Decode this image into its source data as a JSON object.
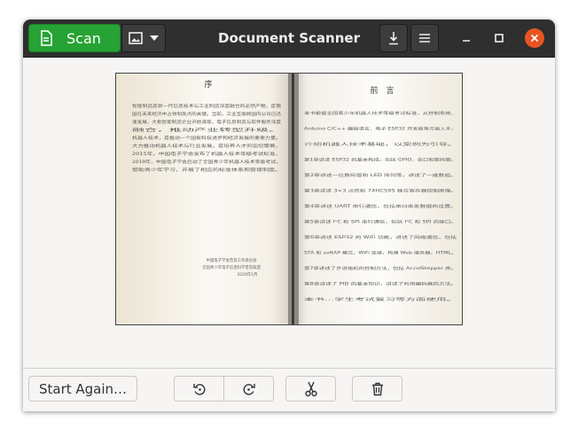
{
  "window": {
    "title": "Document Scanner"
  },
  "toolbar": {
    "scan_label": "Scan",
    "scan_icon": "document-icon",
    "type_icon": "photo-icon",
    "save_icon": "download-icon",
    "menu_icon": "hamburger-menu-icon"
  },
  "colors": {
    "accent": "#26a334",
    "header_bg": "#2f2f2f",
    "close": "#e95420"
  },
  "scan": {
    "left_page": {
      "heading": "序",
      "lines": [
        "智能制造是新一代信息技术与工业制造深度融合的必然产物，是我",
        "国在未来经济中占领制高点的关键。当前，工业互联网国内公司已迅",
        "速发展，大批智能制造企业开始涌现，电子信息制造与软件服务深度",
        "融合，推动产业转型升级。",
        "机器人技术，是推动一个国家科技进步和经济发展的重要力量。",
        "大力推动机器人技术与行业发展，是培养人才的迫切需要。",
        "2015年，中国电子学会发布了机器人技术等级考试标准，",
        "2019年，中国电子学会启动了全国青少年机器人技术等级考试，",
        "帮助青少年学习，开展了相应的标准体系和管理制度。"
      ],
      "signature": "中国电子学会普及工作委员会",
      "signature2": "全国青少年电子信息科学普及联盟",
      "date": "2020年1月"
    },
    "right_page": {
      "heading": "前　言",
      "lines": [
        "本书根据全国青少年机器人技术等级考试标准，从控制系统、",
        "Arduino C/C++ 编程语言、电子 ESP32 开发板等方面入手，",
        "介绍机器人技术基础，以案例为引导。",
        "第1章讲述 ESP32 的基本构成，包括 GPIO、串口和数码管。",
        "第2章讲述一位数码管和 LED 阵列等，讲述了一维数组。",
        "第3章讲述 3×3 点阵和 74HC595 移位寄存器控制原理。",
        "第4章讲述 UART 串行通信，包括串口收发数据的设置。",
        "第5章讲述 I²C 和 SPI 串行通信，包括 I²C 和 SPI 的接口。",
        "第6章讲述 ESP32 的 WiFi 功能，讲述了网络通信，包括",
        "STA 和 softAP 模式，WiFi 连接，构建 Web 服务器，HTML。",
        "第7章讲述了步进电机的控制方法，包括 AccelStepper 库。",
        "第8章讲述了 PID 的基本知识，讲述了利用编码器的方法。",
        "本书...学生考试复习等方面使用。"
      ]
    }
  },
  "footer": {
    "start_again_label": "Start Again…",
    "rotate_left_icon": "rotate-left-icon",
    "rotate_right_icon": "rotate-right-icon",
    "crop_icon": "scissors-icon",
    "delete_icon": "trash-icon"
  }
}
